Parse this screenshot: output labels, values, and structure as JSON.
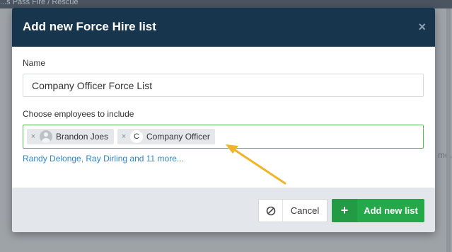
{
  "backdrop": {
    "header_text": "...s Pass Fire / Rescue",
    "side_text": "me."
  },
  "modal": {
    "title": "Add new Force Hire list",
    "close_symbol": "×"
  },
  "form": {
    "name_label": "Name",
    "name_value": "Company Officer Force List",
    "employees_label": "Choose employees to include",
    "tags": [
      {
        "remove": "×",
        "label": "Brandon Joes",
        "icon": "user-avatar-icon"
      },
      {
        "remove": "×",
        "initial": "C",
        "label": "Company Officer",
        "icon": "initial-avatar-icon"
      }
    ],
    "more_link": "Randy Delonge, Ray Dirling and 11 more..."
  },
  "footer": {
    "cancel_label": "Cancel",
    "cancel_icon": "ban-icon",
    "add_label": "Add new list",
    "add_icon_symbol": "+"
  },
  "colors": {
    "header_bg": "#17354c",
    "primary_green": "#25a84a",
    "link_blue": "#2e87c9",
    "annotation_arrow": "#f0b429"
  }
}
